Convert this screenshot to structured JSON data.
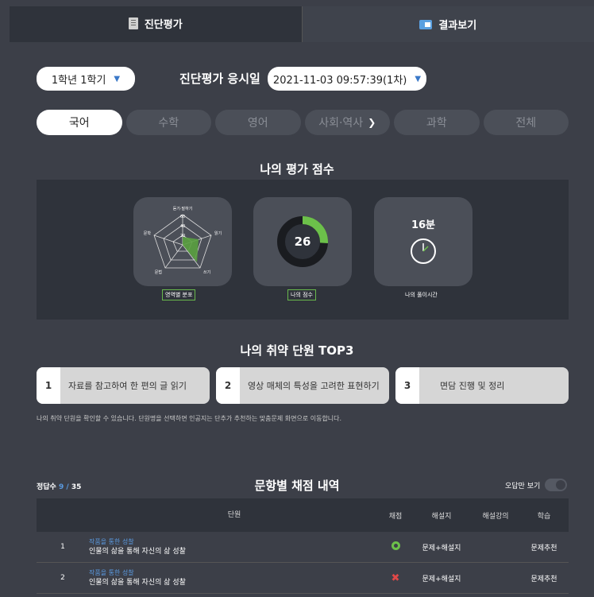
{
  "top_tabs": [
    {
      "label": "진단평가",
      "icon": "document-icon"
    },
    {
      "label": "결과보기",
      "icon": "result-icon"
    }
  ],
  "grade_select": {
    "value": "1학년 1학기"
  },
  "date_label": "진단평가 응시일",
  "date_select": {
    "value": "2021-11-03 09:57:39(1차)"
  },
  "subjects": [
    "국어",
    "수학",
    "영어",
    "사회·역사",
    "과학",
    "전체"
  ],
  "score_title": "나의 평가 점수",
  "radar": {
    "axes": [
      "듣기·말하기",
      "읽기",
      "쓰기",
      "문법",
      "문학"
    ],
    "ticks": [
      "60",
      "40",
      "20"
    ],
    "label": "영역별 분포"
  },
  "score": {
    "value": "26",
    "fraction": 0.26,
    "label": "나의 점수"
  },
  "time": {
    "value": "16분",
    "label": "나의 풀이시간"
  },
  "weak_title": "나의 취약 단원 TOP3",
  "weak_units": [
    {
      "num": "1",
      "text": "자료를 참고하여 한 편의 글 읽기"
    },
    {
      "num": "2",
      "text": "영상 매체의 특성을 고려한 표현하기"
    },
    {
      "num": "3",
      "text": "면담 진행 및 정리"
    }
  ],
  "weak_note": "나의 취약 단원을 확인할 수 있습니다. 단원명을 선택하면 인공지는 단추가 추천하는 맞춤문제 화면으로 이동합니다.",
  "result": {
    "count_label": "정답수",
    "correct": "9",
    "total": "35",
    "title": "문항별 채점 내역",
    "wrong_only_label": "오답만 보기",
    "headers": {
      "unit": "단원",
      "score": "채점",
      "sheet": "해설지",
      "lecture": "해설강의",
      "study": "학습"
    },
    "rows": [
      {
        "no": "1",
        "tag": "작품을 통한 성찰",
        "unit": "인물의 삶을 통해 자신의 삶 성찰",
        "result": "correct",
        "sheet": "문제+해설지",
        "study": "문제추천"
      },
      {
        "no": "2",
        "tag": "작품을 통한 성찰",
        "unit": "인물의 삶을 통해 자신의 삶 성찰",
        "result": "wrong",
        "sheet": "문제+해설지",
        "study": "문제추천"
      }
    ]
  }
}
